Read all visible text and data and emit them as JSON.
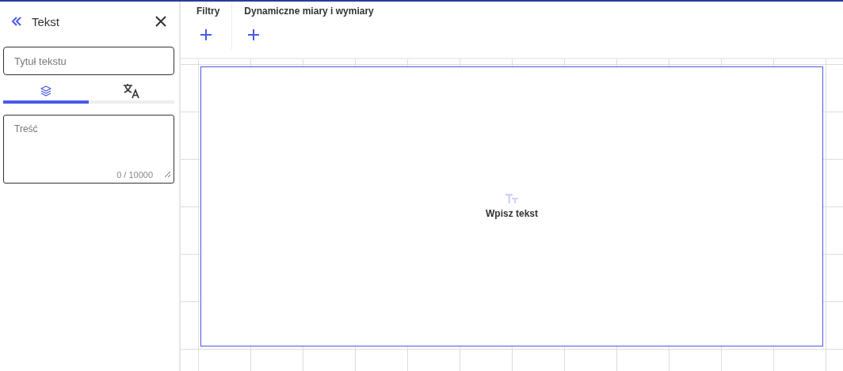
{
  "panel": {
    "title": "Tekst",
    "title_field": {
      "placeholder": "Tytuł tekstu"
    },
    "tabs": [
      {
        "kind": "layers",
        "selected": true
      },
      {
        "kind": "translate",
        "selected": false
      }
    ],
    "content_field": {
      "placeholder": "Treść",
      "counter": "0 / 10000"
    }
  },
  "toolbar": {
    "groups": [
      {
        "label": "Filtry"
      },
      {
        "label": "Dynamiczne miary i wymiary"
      }
    ]
  },
  "canvas": {
    "text_widget": {
      "label": "Wpisz tekst"
    }
  }
}
